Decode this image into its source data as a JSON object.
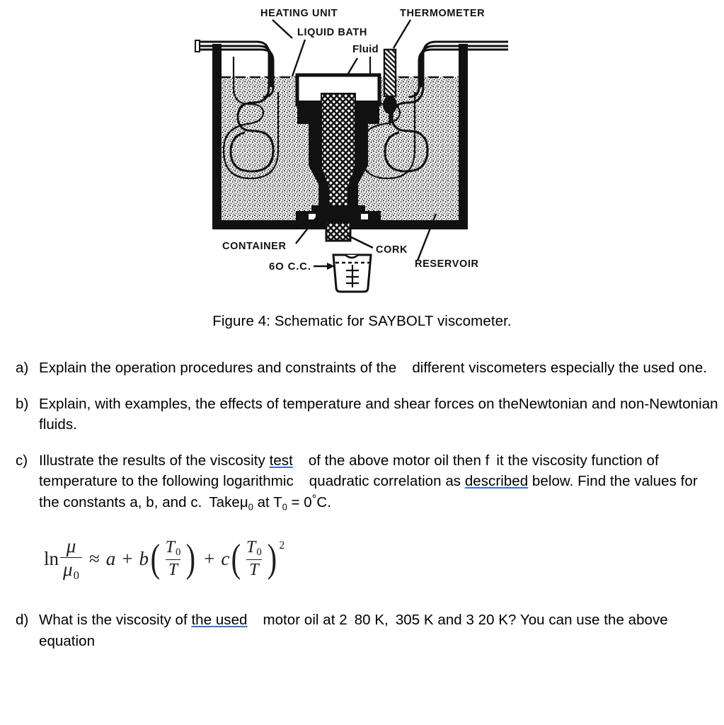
{
  "figure": {
    "caption": "Figure 4: Schematic for SAYBOLT viscometer.",
    "labels": {
      "heating_unit": "HEATING UNIT",
      "liquid_bath": "LIQUID BATH",
      "fluid": "Fluid",
      "thermometer": "THERMOMETER",
      "container": "CONTAINER",
      "cork": "CORK",
      "reservoir": "RESERVOIR",
      "volume": "6O C.C."
    }
  },
  "questions": [
    {
      "marker": "a)",
      "segments": [
        {
          "text": "Explain the operation procedures and constraints of the",
          "style": "normal"
        },
        {
          "text": "",
          "style": "gap"
        },
        {
          "text": "different viscometers especially the used one.",
          "style": "normal"
        }
      ]
    },
    {
      "marker": "b)",
      "segments": [
        {
          "text": "Explain, with examples, the effects of temperature and shear forces on theNewtonian and non-Newtonian fluids.",
          "style": "normal"
        }
      ]
    },
    {
      "marker": "c)",
      "segments": [
        {
          "text": "Illustrate the results of the viscosity ",
          "style": "normal"
        },
        {
          "text": "test",
          "style": "misspell"
        },
        {
          "text": "",
          "style": "gap"
        },
        {
          "text": "of the above motor oil then f",
          "style": "normal"
        },
        {
          "text": "",
          "style": "gap-sm"
        },
        {
          "text": "it the viscosity function of temperature to the following logarithmic",
          "style": "normal"
        },
        {
          "text": "",
          "style": "gap"
        },
        {
          "text": "quadratic correlation as ",
          "style": "normal"
        },
        {
          "text": "described",
          "style": "misspell"
        },
        {
          "text": " below. Find the values for the constants a, b, and c.",
          "style": "normal"
        },
        {
          "text": "",
          "style": "gap-sm"
        },
        {
          "text": "Takeμ",
          "style": "normal"
        },
        {
          "text": "0",
          "style": "sub"
        },
        {
          "text": " at T",
          "style": "normal"
        },
        {
          "text": "0",
          "style": "sub"
        },
        {
          "text": " = 0",
          "style": "normal"
        },
        {
          "text": "°",
          "style": "deg"
        },
        {
          "text": "C.",
          "style": "normal"
        }
      ]
    },
    {
      "marker": "d)",
      "segments": [
        {
          "text": "What is the viscosity of ",
          "style": "normal"
        },
        {
          "text": "the used",
          "style": "misspell"
        },
        {
          "text": "",
          "style": "gap"
        },
        {
          "text": "motor oil at 2",
          "style": "normal"
        },
        {
          "text": "",
          "style": "gap-sm"
        },
        {
          "text": "80 K,",
          "style": "normal"
        },
        {
          "text": "",
          "style": "gap-sm"
        },
        {
          "text": "305 K and 3 20 K? You can use the above equation",
          "style": "normal"
        }
      ]
    }
  ],
  "equation": {
    "ln": "ln",
    "mu": "μ",
    "mu0_base": "μ",
    "mu0_sub": "0",
    "approx": "≈",
    "a": "a",
    "plus1": "+",
    "b": "b",
    "T0_base": "T",
    "T0_sub": "0",
    "T": "T",
    "plus2": "+",
    "c": "c",
    "exponent": "2",
    "paren_open": "(",
    "paren_close": ")"
  },
  "colors": {
    "ink": "#000000",
    "spell_underline": "#3a6fd8",
    "equation_ink": "#1c1c22",
    "page_bg": "#ffffff"
  }
}
